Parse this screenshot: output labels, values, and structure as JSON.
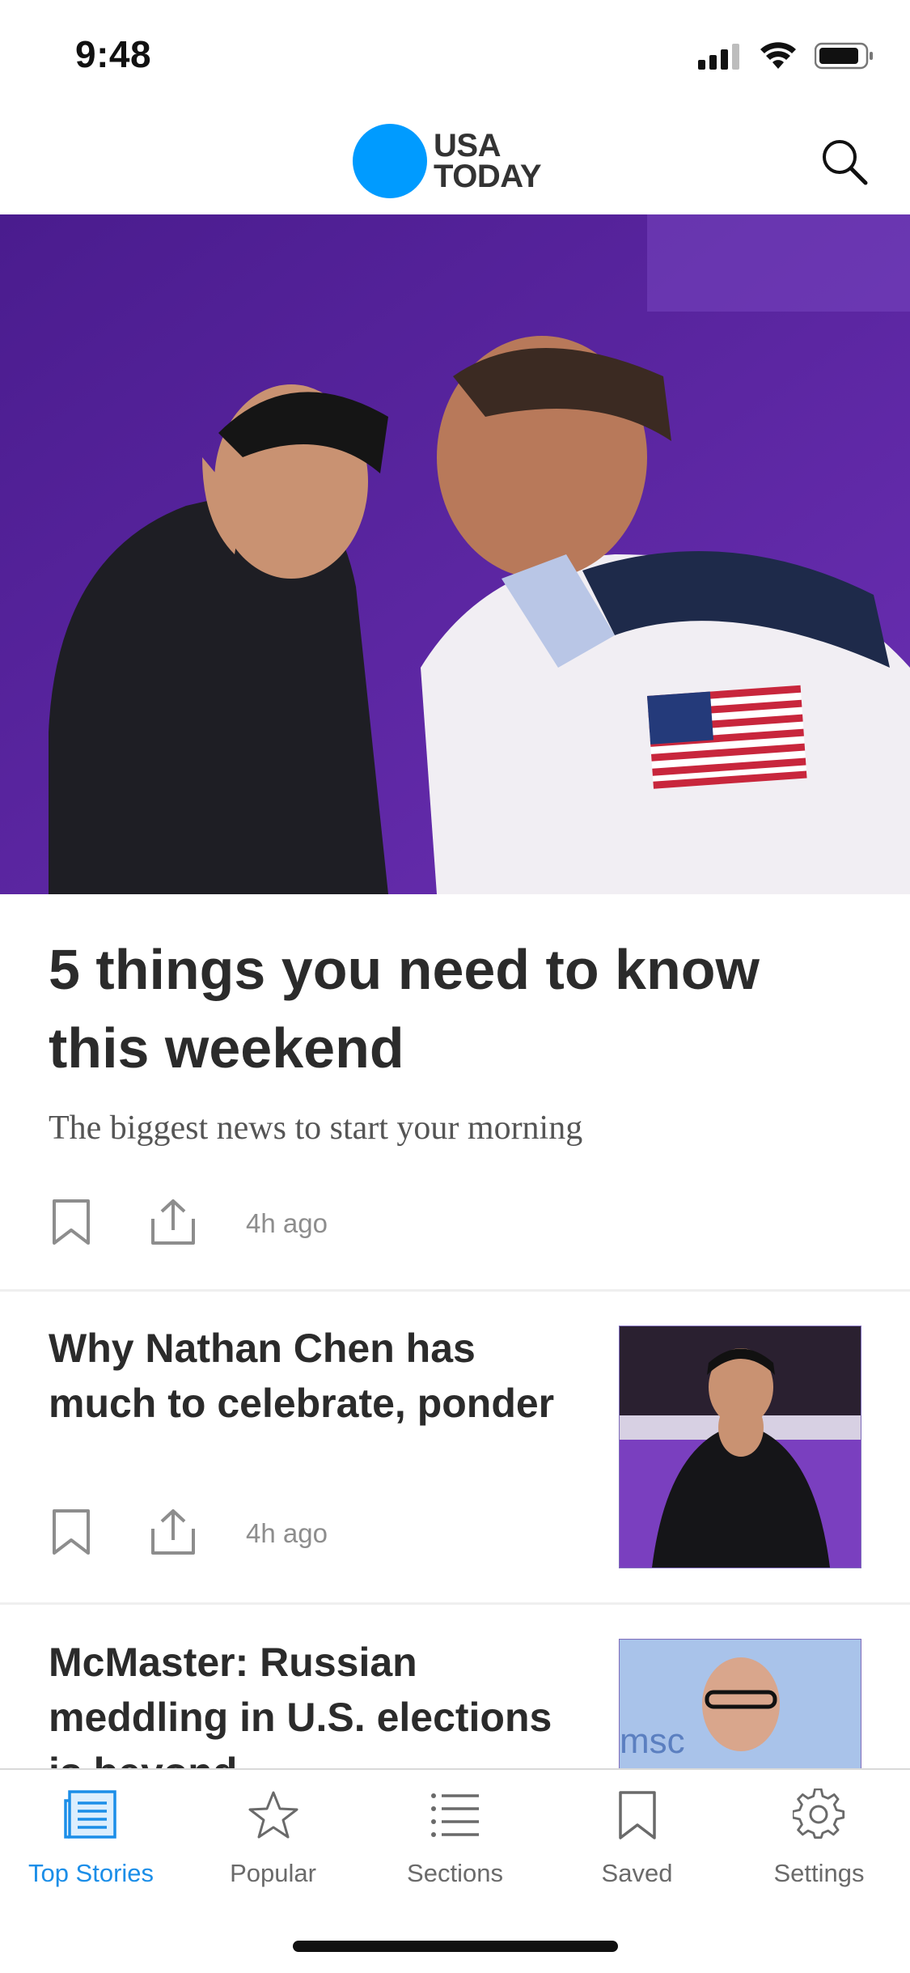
{
  "status_bar": {
    "time": "9:48"
  },
  "header": {
    "logo_line1": "USA",
    "logo_line2": "TODAY",
    "brand_color": "#009bff",
    "search_icon": "search-icon"
  },
  "hero": {
    "headline": "5 things you need to know this weekend",
    "subtitle": "The biggest news to start your morning",
    "time_ago": "4h ago",
    "image_bg": "#5a1f9a"
  },
  "stories": [
    {
      "title": "Why Nathan Chen has much to celebrate, ponder",
      "time_ago": "4h ago"
    },
    {
      "title": "McMaster: Russian meddling in U.S. elections is beyond"
    }
  ],
  "tabs": [
    {
      "label": "Top Stories",
      "icon": "newspaper-icon",
      "active": true
    },
    {
      "label": "Popular",
      "icon": "star-icon",
      "active": false
    },
    {
      "label": "Sections",
      "icon": "list-icon",
      "active": false
    },
    {
      "label": "Saved",
      "icon": "bookmark-icon",
      "active": false
    },
    {
      "label": "Settings",
      "icon": "gear-icon",
      "active": false
    }
  ],
  "colors": {
    "accent": "#1b8ee8",
    "text": "#2b2b2b",
    "muted": "#8d8d8d"
  }
}
